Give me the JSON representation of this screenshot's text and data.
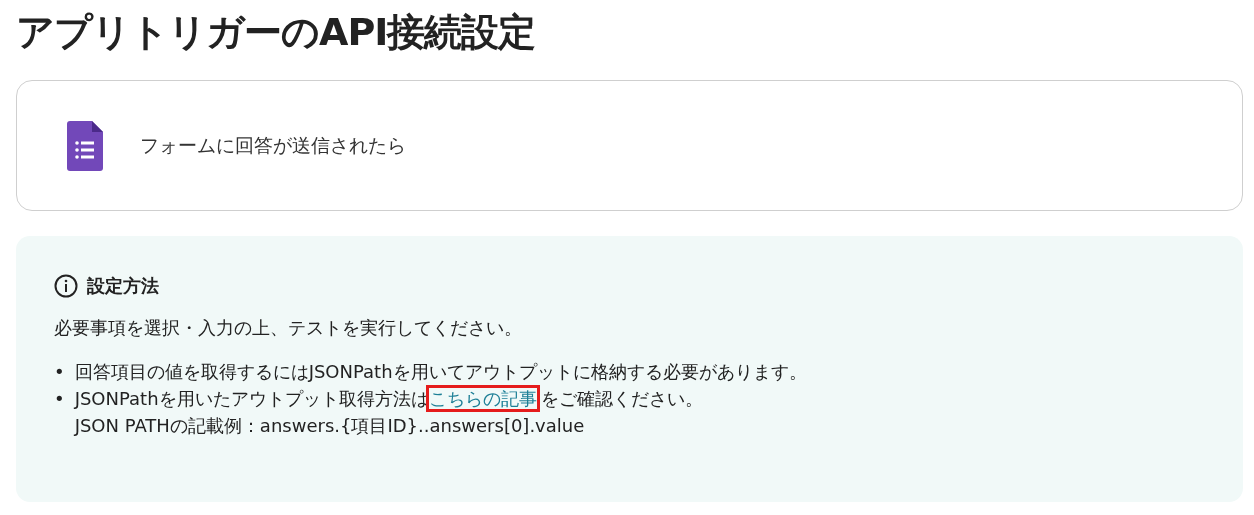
{
  "title": "アプリトリガーのAPI接続設定",
  "trigger": {
    "label": "フォームに回答が送信されたら"
  },
  "info": {
    "heading": "設定方法",
    "intro": "必要事項を選択・入力の上、テストを実行してください。",
    "bullets": [
      {
        "kind": "text",
        "marker": "•",
        "text": "回答項目の値を取得するにはJSONPathを用いてアウトプットに格納する必要があります。"
      },
      {
        "kind": "link",
        "marker": "•",
        "before": "JSONPathを用いたアウトプット取得方法は",
        "link": "こちらの記事",
        "highlighted": true,
        "after": "をご確認ください。",
        "note": "JSON PATHの記載例：answers.{項目ID}..answers[0].value"
      }
    ]
  }
}
